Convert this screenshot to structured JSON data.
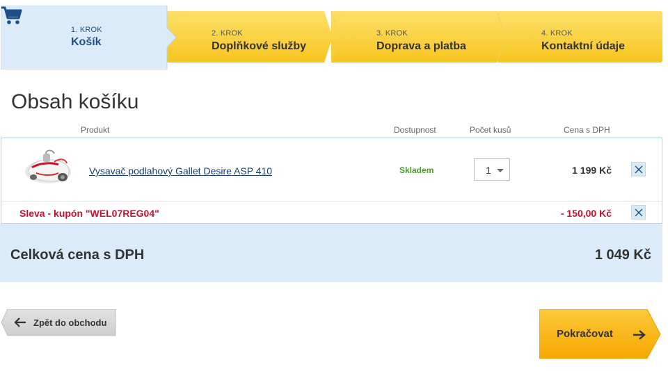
{
  "steps": [
    {
      "num": "1. KROK",
      "label": "Košík"
    },
    {
      "num": "2. KROK",
      "label": "Doplňkové služby"
    },
    {
      "num": "3. KROK",
      "label": "Doprava a platba"
    },
    {
      "num": "4. KROK",
      "label": "Kontaktní údaje"
    }
  ],
  "page_title": "Obsah košíku",
  "columns": {
    "product": "Produkt",
    "availability": "Dostupnost",
    "quantity": "Počet kusů",
    "price": "Cena s DPH"
  },
  "item": {
    "name": "Vysavač podlahový Gallet Desire ASP 410",
    "availability": "Skladem",
    "quantity": "1",
    "price": "1 199 Kč"
  },
  "discount": {
    "label": "Sleva - kupón \"WEL07REG04\"",
    "value": "- 150,00 Kč"
  },
  "total": {
    "label": "Celková cena s DPH",
    "value": "1 049 Kč"
  },
  "buttons": {
    "back": "Zpět do obchodu",
    "continue": "Pokračovat"
  },
  "colors": {
    "step_yellow": "#fcd23a",
    "step_active_bg": "#dcebf9",
    "accent_blue": "#1c4f8a",
    "discount_red": "#c8102e",
    "stock_green": "#4a9a2a",
    "continue_orange": "#fbb918"
  },
  "icons": {
    "cart": "cart-icon",
    "remove": "close-icon",
    "back": "arrow-left-icon",
    "continue": "arrow-right-icon"
  }
}
